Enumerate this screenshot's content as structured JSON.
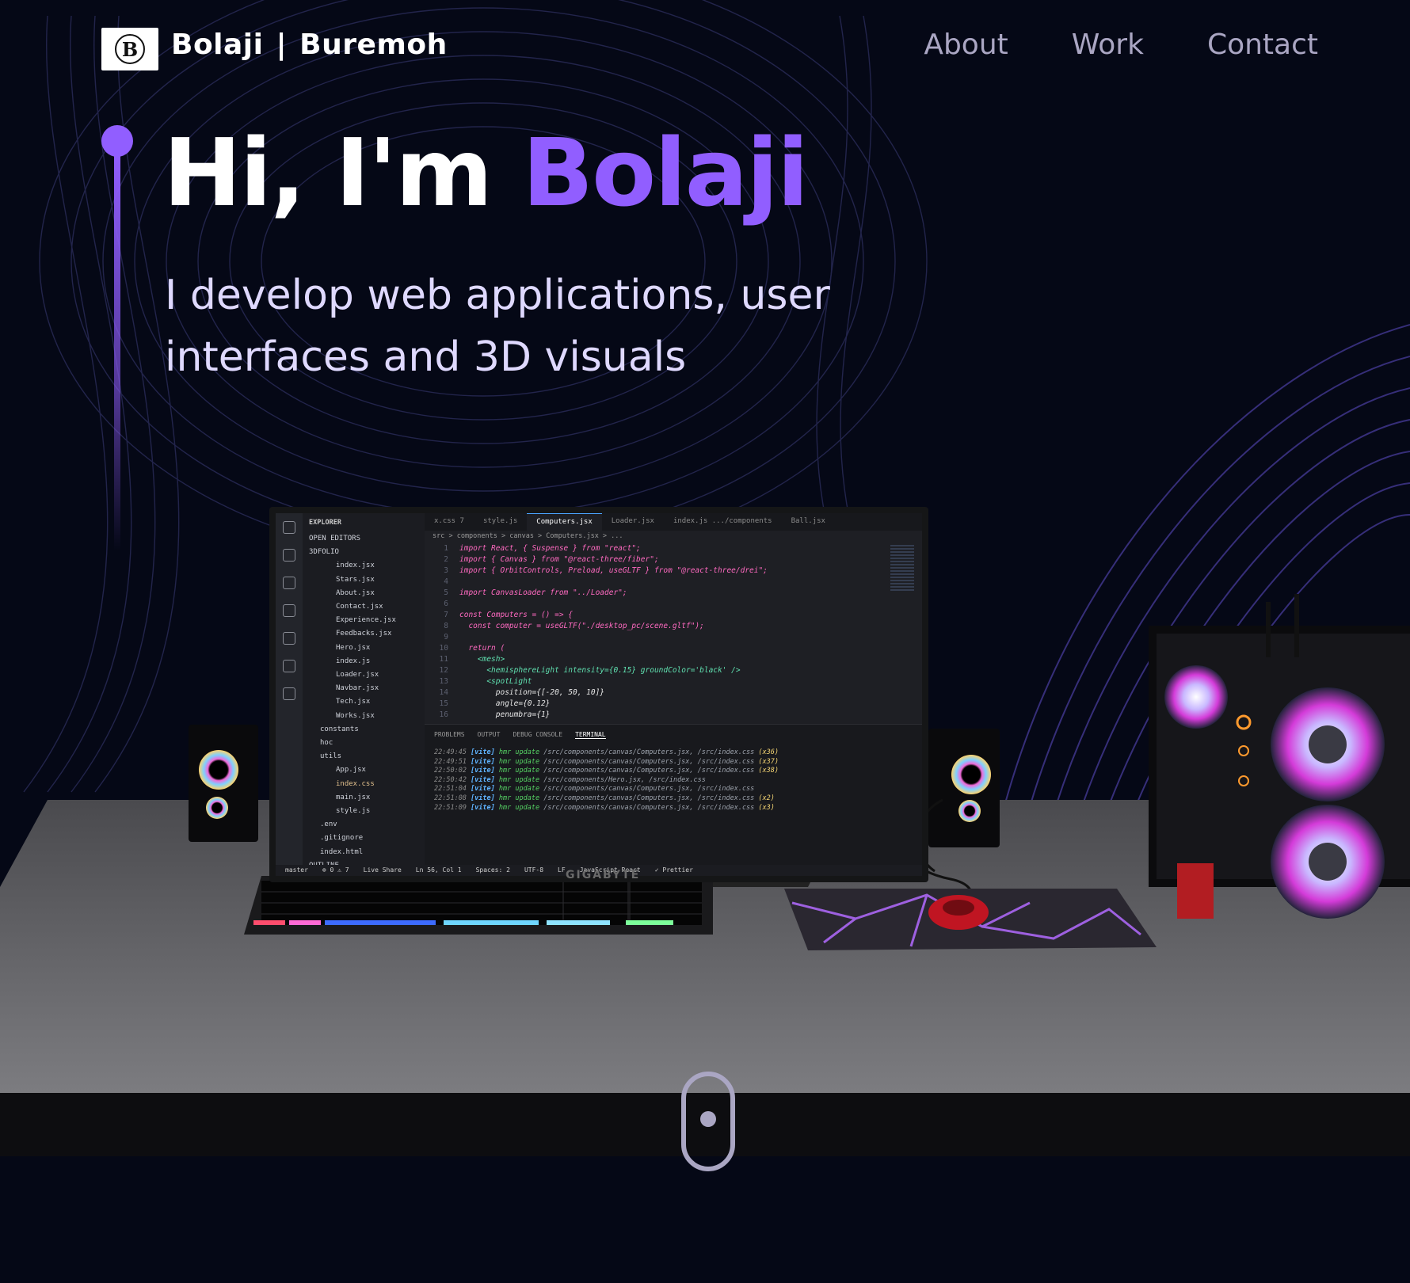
{
  "nav": {
    "logo_letter": "B",
    "brand_first": "Bolaji",
    "brand_separator": "|",
    "brand_last": "Buremoh",
    "links": [
      "About",
      "Work",
      "Contact"
    ]
  },
  "hero": {
    "greeting": "Hi, I'm",
    "name": "Bolaji",
    "subtitle": "I develop web applications, user interfaces and 3D visuals"
  },
  "editor": {
    "explorer_title": "EXPLORER",
    "open_editors": "OPEN EDITORS",
    "project": "3DFOLIO",
    "files": [
      {
        "name": "index.jsx",
        "depth": 2
      },
      {
        "name": "Stars.jsx",
        "depth": 2
      },
      {
        "name": "About.jsx",
        "depth": 2
      },
      {
        "name": "Contact.jsx",
        "depth": 2
      },
      {
        "name": "Experience.jsx",
        "depth": 2
      },
      {
        "name": "Feedbacks.jsx",
        "depth": 2
      },
      {
        "name": "Hero.jsx",
        "depth": 2
      },
      {
        "name": "index.js",
        "depth": 2
      },
      {
        "name": "Loader.jsx",
        "depth": 2
      },
      {
        "name": "Navbar.jsx",
        "depth": 2
      },
      {
        "name": "Tech.jsx",
        "depth": 2
      },
      {
        "name": "Works.jsx",
        "depth": 2
      },
      {
        "name": "constants",
        "depth": 1
      },
      {
        "name": "hoc",
        "depth": 1
      },
      {
        "name": "utils",
        "depth": 1
      },
      {
        "name": "App.jsx",
        "depth": 2
      },
      {
        "name": "index.css",
        "depth": 2
      },
      {
        "name": "main.jsx",
        "depth": 2
      },
      {
        "name": "style.js",
        "depth": 2
      },
      {
        "name": ".env",
        "depth": 1
      },
      {
        "name": ".gitignore",
        "depth": 1
      },
      {
        "name": "index.html",
        "depth": 1
      },
      {
        "name": "OUTLINE",
        "depth": 0
      }
    ],
    "tabs": [
      "x.css 7",
      "style.js",
      "Computers.jsx",
      "Loader.jsx",
      "index.js .../components",
      "Ball.jsx"
    ],
    "active_tab": "Computers.jsx",
    "breadcrumb": "src > components > canvas > Computers.jsx > ...",
    "code": [
      "import React, { Suspense } from \"react\";",
      "import { Canvas } from \"@react-three/fiber\";",
      "import { OrbitControls, Preload, useGLTF } from \"@react-three/drei\";",
      "",
      "import CanvasLoader from \"../Loader\";",
      "",
      "const Computers = () => {",
      "  const computer = useGLTF(\"./desktop_pc/scene.gltf\");",
      "",
      "  return (",
      "    <mesh>",
      "      <hemisphereLight intensity={0.15} groundColor='black' />",
      "      <spotLight",
      "        position={[-20, 50, 10]}",
      "        angle={0.12}",
      "        penumbra={1}"
    ],
    "panel_tabs": [
      "PROBLEMS",
      "OUTPUT",
      "DEBUG CONSOLE",
      "TERMINAL"
    ],
    "terminal": [
      {
        "time": "22:49:45",
        "path": "/src/components/canvas/Computers.jsx, /src/index.css",
        "count": "(x36)"
      },
      {
        "time": "22:49:51",
        "path": "/src/components/canvas/Computers.jsx, /src/index.css",
        "count": "(x37)"
      },
      {
        "time": "22:50:02",
        "path": "/src/components/canvas/Computers.jsx, /src/index.css",
        "count": "(x38)"
      },
      {
        "time": "22:50:42",
        "path": "/src/components/Hero.jsx, /src/index.css",
        "count": ""
      },
      {
        "time": "22:51:04",
        "path": "/src/components/canvas/Computers.jsx, /src/index.css",
        "count": ""
      },
      {
        "time": "22:51:08",
        "path": "/src/components/canvas/Computers.jsx, /src/index.css",
        "count": "(x2)"
      },
      {
        "time": "22:51:09",
        "path": "/src/components/canvas/Computers.jsx, /src/index.css",
        "count": "(x3)"
      }
    ],
    "status": [
      "master",
      "⊗ 0 ⚠ 7",
      "Live Share",
      "Ln 56, Col 1",
      "Spaces: 2",
      "UTF-8",
      "LF",
      "JavaScript React",
      "✓ Prettier"
    ],
    "monitor_brand": "GIGABYTE"
  },
  "colors": {
    "background": "#050816",
    "accent": "#915eff",
    "nav_text": "#aaa6c3"
  },
  "icons": {
    "scroll": "mouse-scroll-icon",
    "logo": "circle-b-logo-icon"
  }
}
